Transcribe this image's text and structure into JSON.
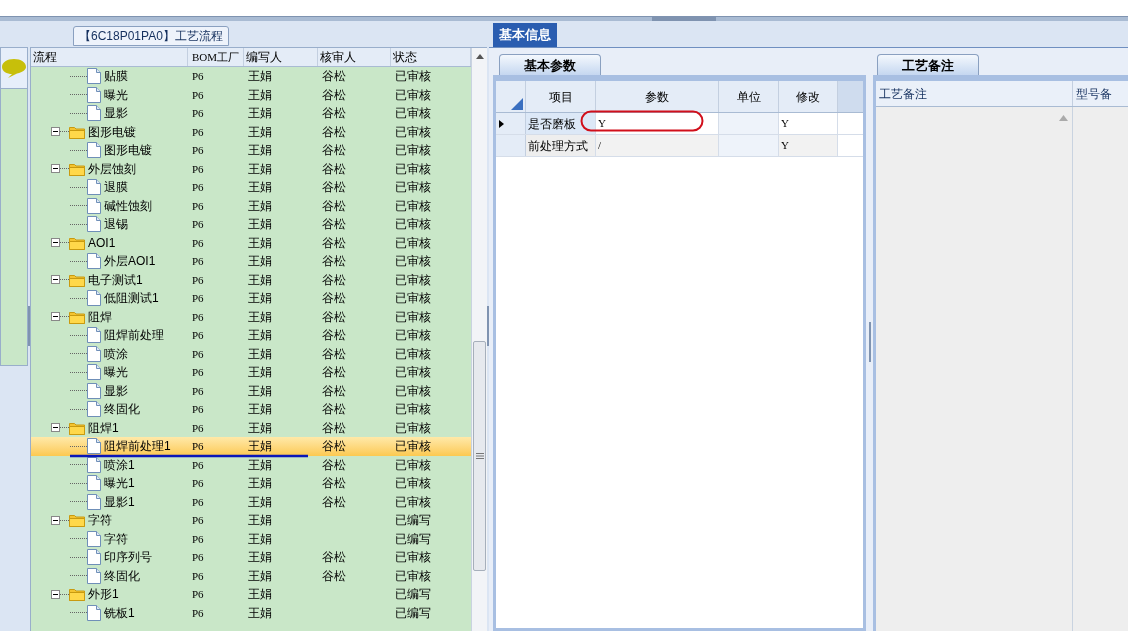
{
  "flow_panel": {
    "title": "【6C18P01PA0】工艺流程",
    "columns": [
      "流程",
      "BOM工厂",
      "编写人",
      "核审人",
      "状态"
    ],
    "tree": [
      {
        "children": [
          {
            "label": "贴膜",
            "bom": "P6",
            "author": "王娟",
            "reviewer": "谷松",
            "status": "已审核",
            "selected": false
          },
          {
            "label": "曝光",
            "bom": "P6",
            "author": "王娟",
            "reviewer": "谷松",
            "status": "已审核",
            "selected": false
          },
          {
            "label": "显影",
            "bom": "P6",
            "author": "王娟",
            "reviewer": "谷松",
            "status": "已审核",
            "selected": false
          }
        ]
      },
      {
        "label": "图形电镀",
        "bom": "P6",
        "author": "王娟",
        "reviewer": "谷松",
        "status": "已审核",
        "selected": false,
        "expanded": true,
        "children": [
          {
            "label": "图形电镀",
            "bom": "P6",
            "author": "王娟",
            "reviewer": "谷松",
            "status": "已审核",
            "selected": false
          }
        ]
      },
      {
        "label": "外层蚀刻",
        "bom": "P6",
        "author": "王娟",
        "reviewer": "谷松",
        "status": "已审核",
        "selected": false,
        "expanded": true,
        "children": [
          {
            "label": "退膜",
            "bom": "P6",
            "author": "王娟",
            "reviewer": "谷松",
            "status": "已审核",
            "selected": false
          },
          {
            "label": "碱性蚀刻",
            "bom": "P6",
            "author": "王娟",
            "reviewer": "谷松",
            "status": "已审核",
            "selected": false
          },
          {
            "label": "退锡",
            "bom": "P6",
            "author": "王娟",
            "reviewer": "谷松",
            "status": "已审核",
            "selected": false
          }
        ]
      },
      {
        "label": "AOI1",
        "bom": "P6",
        "author": "王娟",
        "reviewer": "谷松",
        "status": "已审核",
        "selected": false,
        "expanded": true,
        "children": [
          {
            "label": "外层AOI1",
            "bom": "P6",
            "author": "王娟",
            "reviewer": "谷松",
            "status": "已审核",
            "selected": false
          }
        ]
      },
      {
        "label": "电子测试1",
        "bom": "P6",
        "author": "王娟",
        "reviewer": "谷松",
        "status": "已审核",
        "selected": false,
        "expanded": true,
        "children": [
          {
            "label": "低阻测试1",
            "bom": "P6",
            "author": "王娟",
            "reviewer": "谷松",
            "status": "已审核",
            "selected": false
          }
        ]
      },
      {
        "label": "阻焊",
        "bom": "P6",
        "author": "王娟",
        "reviewer": "谷松",
        "status": "已审核",
        "selected": false,
        "expanded": true,
        "children": [
          {
            "label": "阻焊前处理",
            "bom": "P6",
            "author": "王娟",
            "reviewer": "谷松",
            "status": "已审核",
            "selected": false
          },
          {
            "label": "喷涂",
            "bom": "P6",
            "author": "王娟",
            "reviewer": "谷松",
            "status": "已审核",
            "selected": false
          },
          {
            "label": "曝光",
            "bom": "P6",
            "author": "王娟",
            "reviewer": "谷松",
            "status": "已审核",
            "selected": false
          },
          {
            "label": "显影",
            "bom": "P6",
            "author": "王娟",
            "reviewer": "谷松",
            "status": "已审核",
            "selected": false
          },
          {
            "label": "终固化",
            "bom": "P6",
            "author": "王娟",
            "reviewer": "谷松",
            "status": "已审核",
            "selected": false
          }
        ]
      },
      {
        "label": "阻焊1",
        "bom": "P6",
        "author": "王娟",
        "reviewer": "谷松",
        "status": "已审核",
        "selected": false,
        "expanded": true,
        "children": [
          {
            "label": "阻焊前处理1",
            "bom": "P6",
            "author": "王娟",
            "reviewer": "谷松",
            "status": "已审核",
            "selected": true
          },
          {
            "label": "喷涂1",
            "bom": "P6",
            "author": "王娟",
            "reviewer": "谷松",
            "status": "已审核",
            "selected": false
          },
          {
            "label": "曝光1",
            "bom": "P6",
            "author": "王娟",
            "reviewer": "谷松",
            "status": "已审核",
            "selected": false
          },
          {
            "label": "显影1",
            "bom": "P6",
            "author": "王娟",
            "reviewer": "谷松",
            "status": "已审核",
            "selected": false
          }
        ]
      },
      {
        "label": "字符",
        "bom": "P6",
        "author": "王娟",
        "status": "已编写",
        "selected": false,
        "expanded": true,
        "children": [
          {
            "label": "字符",
            "bom": "P6",
            "author": "王娟",
            "status": "已编写",
            "selected": false
          },
          {
            "label": "印序列号",
            "bom": "P6",
            "author": "王娟",
            "reviewer": "谷松",
            "status": "已审核",
            "selected": false
          },
          {
            "label": "终固化",
            "bom": "P6",
            "author": "王娟",
            "reviewer": "谷松",
            "status": "已审核",
            "selected": false
          }
        ]
      },
      {
        "label": "外形1",
        "bom": "P6",
        "author": "王娟",
        "status": "已编写",
        "selected": false,
        "expanded": true,
        "children": [
          {
            "label": "铣板1",
            "bom": "P6",
            "author": "王娟",
            "status": "已编写",
            "selected": false
          }
        ]
      }
    ]
  },
  "main_tab": {
    "label": "基本信息",
    "selected": true
  },
  "params_panel": {
    "tab": {
      "label": "基本参数",
      "selected": true
    },
    "columns": [
      "项目",
      "参数",
      "单位",
      "修改"
    ],
    "rows": [
      {
        "item": "是否磨板",
        "param": "Y",
        "modified": "Y",
        "selected": true
      },
      {
        "item": "前处理方式",
        "param": "/",
        "modified": "Y",
        "selected": false
      }
    ]
  },
  "notes_panel": {
    "tab": {
      "label": "工艺备注",
      "selected": true
    },
    "columns": [
      "工艺备注",
      "型号备"
    ]
  }
}
